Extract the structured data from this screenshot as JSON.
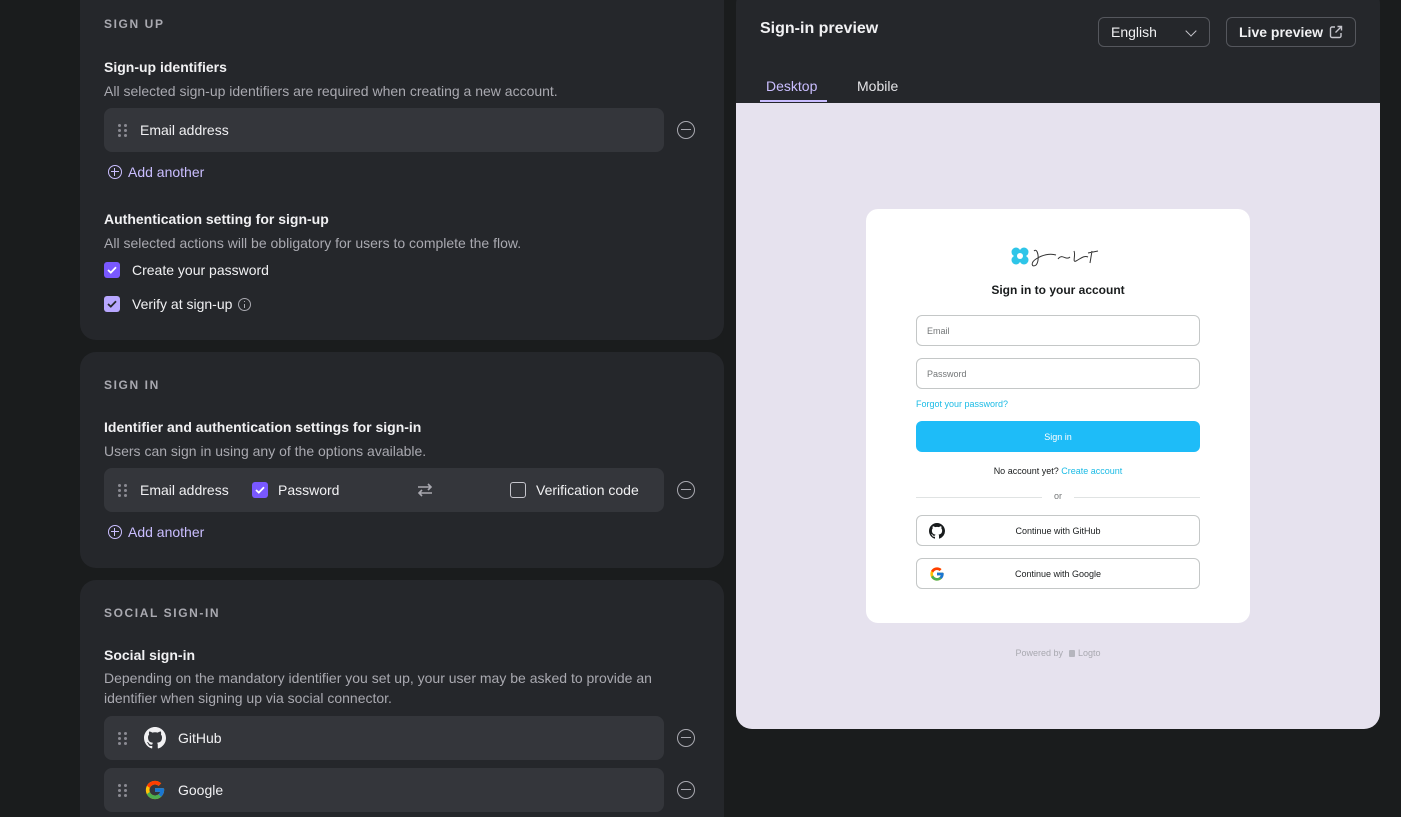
{
  "signup": {
    "section_title": "SIGN UP",
    "identifiers_title": "Sign-up identifiers",
    "identifiers_desc": "All selected sign-up identifiers are required when creating a new account.",
    "identifier_item": "Email address",
    "add_another": "Add another",
    "auth_title": "Authentication setting for sign-up",
    "auth_desc": "All selected actions will be obligatory for users to complete the flow.",
    "create_password": "Create your password",
    "verify_signup": "Verify at sign-up"
  },
  "signin": {
    "section_title": "SIGN IN",
    "title": "Identifier and authentication settings for sign-in",
    "desc": "Users can sign in using any of the options available.",
    "identifier": "Email address",
    "password": "Password",
    "verification_code": "Verification code",
    "add_another": "Add another"
  },
  "social": {
    "section_title": "SOCIAL SIGN-IN",
    "title": "Social sign-in",
    "desc": "Depending on the mandatory identifier you set up, your user may be asked to provide an identifier when signing up via social connector.",
    "connectors": [
      "GitHub",
      "Google"
    ]
  },
  "preview": {
    "title": "Sign-in preview",
    "language": "English",
    "live_preview": "Live preview",
    "tabs": [
      "Desktop",
      "Mobile"
    ],
    "card": {
      "heading": "Sign in to your account",
      "email_placeholder": "Email",
      "password_placeholder": "Password",
      "forgot": "Forgot your password?",
      "signin_button": "Sign in",
      "no_account": "No account yet?",
      "create_account": "Create account",
      "or": "or",
      "github_button": "Continue with GitHub",
      "google_button": "Continue with Google"
    },
    "powered_by": "Powered by",
    "powered_brand": "Logto"
  },
  "colors": {
    "accent": "#7958ff",
    "accent_light": "#cabeff",
    "preview_primary": "#1ebcf8",
    "card_bg": "#25272b",
    "page_bg": "#1a1c1d"
  }
}
